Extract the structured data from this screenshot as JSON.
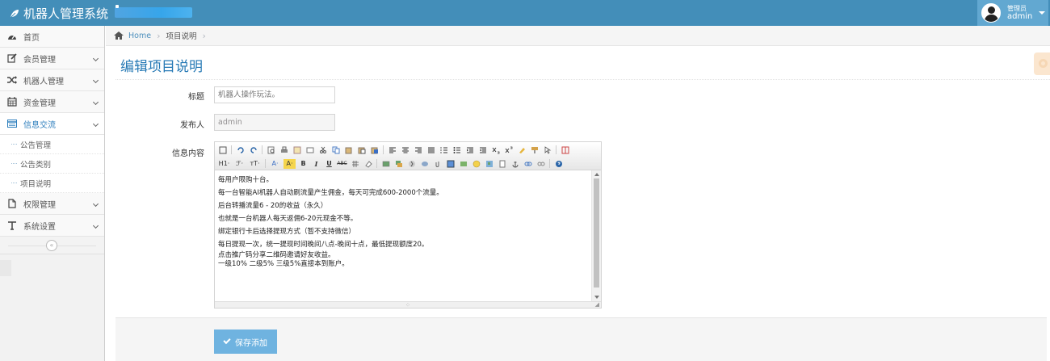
{
  "app": {
    "title": "机器人管理系统",
    "user_role": "管理员",
    "user_name": "admin"
  },
  "sidebar": {
    "items": [
      {
        "label": "首页",
        "icon": "dashboard-icon"
      },
      {
        "label": "会员管理",
        "icon": "edit-icon"
      },
      {
        "label": "机器人管理",
        "icon": "shuffle-icon"
      },
      {
        "label": "资金管理",
        "icon": "calendar-icon"
      },
      {
        "label": "信息交流",
        "icon": "list-icon"
      },
      {
        "label": "权限管理",
        "icon": "file-icon"
      },
      {
        "label": "系统设置",
        "icon": "text-icon"
      }
    ],
    "sub_items": [
      "公告管理",
      "公告类别",
      "项目说明"
    ],
    "collapse_glyph": "«"
  },
  "breadcrumb": {
    "home": "Home",
    "current": "项目说明",
    "separator": "›"
  },
  "page": {
    "title": "编辑项目说明"
  },
  "form": {
    "title_label": "标题",
    "title_placeholder": "机器人操作玩法。",
    "publisher_label": "发布人",
    "publisher_value": "admin",
    "content_label": "信息内容",
    "editor_lines": [
      "每用户限购十台。",
      "每一台智能AI机器人自动刷流量产生佣金，每天可完成600-2000个流量。",
      "后台转播流量6 - 20的收益（永久）",
      "也就是一台机器人每天返佣6-20元现金不等。",
      "绑定银行卡后选择提现方式（暂不支持微信）",
      "每日提现一次，统一提现时间晚间八点-晚间十点，最低提现额度20。",
      "点击推广码分享二维码邀请好友收益。",
      "一级10% 二级5% 三级5%直接本到账户。"
    ],
    "toolbar_text": {
      "heading": "H1·",
      "font": "ℱ·",
      "size": "тT·",
      "font_color": "A·",
      "bg_color": "A·",
      "bold": "B",
      "italic": "I",
      "underline": "U",
      "strike": "ABC"
    },
    "save_label": "保存添加"
  },
  "colors": {
    "navbar": "#438eb9",
    "accent": "#2679b5",
    "button": "#6fb3e0"
  }
}
